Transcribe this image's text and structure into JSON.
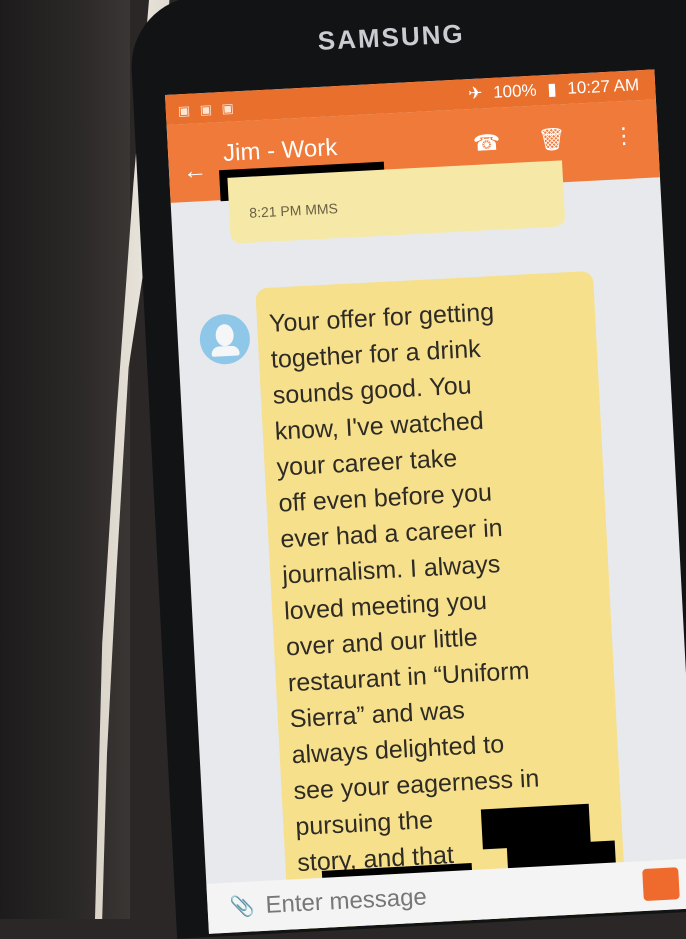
{
  "device": {
    "brand": "SAMSUNG"
  },
  "status_bar": {
    "battery": "100%",
    "time": "10:27 AM"
  },
  "app_bar": {
    "contact_name": "Jim - Work"
  },
  "thread": {
    "previous_message_meta": "8:21 PM MMS",
    "message_text": "Your offer for getting\ntogether for a drink\nsounds good.  You\nknow, I've watched\nyour career take\noff even before you\never had a career in\njournalism. I always\nloved meeting you\nover and our little\nrestaurant in “Uniform\nSierra” and was\nalways delighted to\nsee your eagerness in\npursuing the\nstory, and that\nwas"
  },
  "composer": {
    "placeholder": "Enter message"
  },
  "colors": {
    "app_bar": "#ef7a3a",
    "status_bar": "#e96f2c",
    "bubble": "#f6e08c",
    "screen_bg": "#e7e9ec",
    "redaction": "#000000"
  },
  "icons": [
    "back-arrow-icon",
    "phone-icon",
    "trash-icon",
    "more-vertical-icon",
    "airplane-icon",
    "battery-icon",
    "attachment-icon"
  ]
}
